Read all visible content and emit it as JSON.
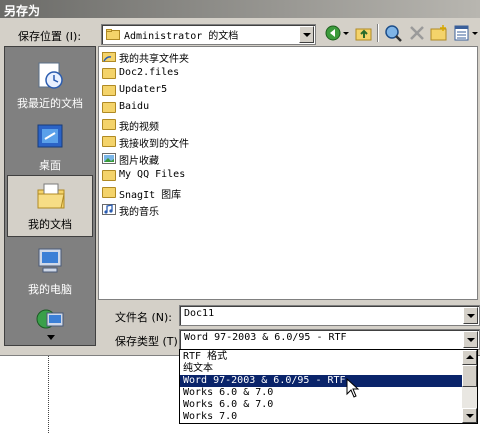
{
  "window": {
    "title": "另存为"
  },
  "save_location": {
    "label": "保存位置 (I):",
    "value": "Administrator 的文档"
  },
  "places": [
    {
      "label": "我最近的文档",
      "icon": "recent-documents-icon"
    },
    {
      "label": "桌面",
      "icon": "desktop-icon"
    },
    {
      "label": "我的文档",
      "icon": "my-documents-icon"
    },
    {
      "label": "我的电脑",
      "icon": "my-computer-icon"
    }
  ],
  "files": [
    {
      "name": "我的共享文件夹",
      "icon": "shared-folder-icon"
    },
    {
      "name": "Doc2.files",
      "icon": "folder-icon"
    },
    {
      "name": "Updater5",
      "icon": "folder-icon"
    },
    {
      "name": "Baidu",
      "icon": "folder-icon"
    },
    {
      "name": "我的视频",
      "icon": "folder-icon"
    },
    {
      "name": "我接收到的文件",
      "icon": "folder-icon"
    },
    {
      "name": "图片收藏",
      "icon": "pictures-folder-icon"
    },
    {
      "name": "My QQ Files",
      "icon": "folder-icon"
    },
    {
      "name": "SnagIt 图库",
      "icon": "folder-icon"
    },
    {
      "name": "我的音乐",
      "icon": "music-folder-icon"
    }
  ],
  "filename": {
    "label": "文件名 (N):",
    "value": "Doc11"
  },
  "filetype": {
    "label": "保存类型 (T):",
    "value": "Word 97-2003 & 6.0/95 - RTF",
    "options": [
      "RTF 格式",
      "纯文本",
      "Word 97-2003 & 6.0/95 - RTF",
      "Works 6.0 & 7.0",
      "Works 6.0 & 7.0",
      "Works 7.0"
    ],
    "selected_index": 2
  },
  "colors": {
    "selection": "#0a246a",
    "dialog_bg": "#d4d0c8",
    "places_bg": "#808080"
  }
}
